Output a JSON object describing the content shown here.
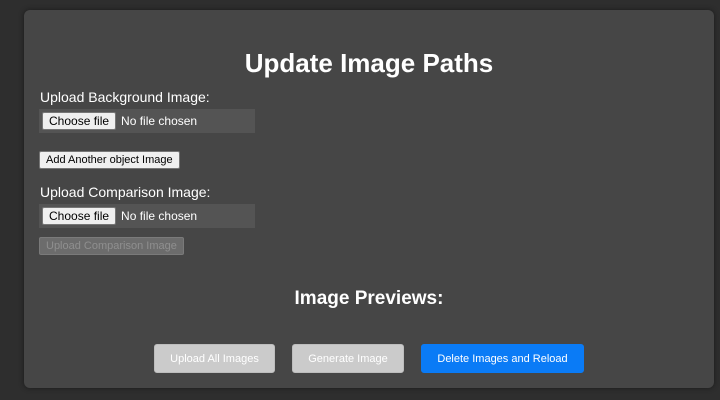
{
  "page": {
    "title": "Update Image Paths",
    "previews_heading": "Image Previews:"
  },
  "background_upload": {
    "label": "Upload Background Image:",
    "choose_label": "Choose file",
    "status": "No file chosen"
  },
  "add_object_label": "Add Another object Image",
  "comparison_upload": {
    "label": "Upload Comparison Image:",
    "choose_label": "Choose file",
    "status": "No file chosen",
    "upload_button_label": "Upload Comparison Image",
    "upload_button_disabled": true
  },
  "actions": {
    "upload_all_label": "Upload All Images",
    "generate_label": "Generate Image",
    "delete_label": "Delete Images and Reload"
  },
  "colors": {
    "page_background": "#2e2e2e",
    "panel_background": "#464646",
    "primary_blue": "#0a7bf6",
    "disabled_gray": "#cbcbcb"
  }
}
